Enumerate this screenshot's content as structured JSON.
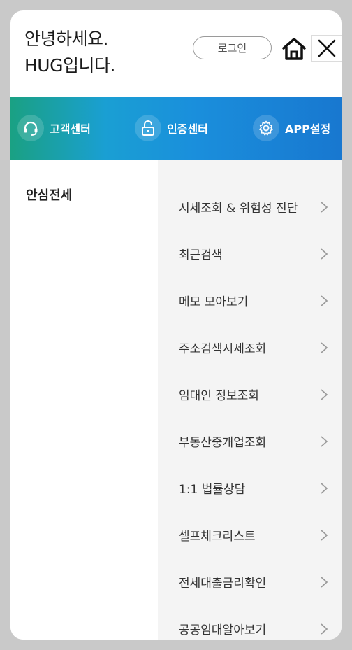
{
  "greeting": {
    "line1": "안녕하세요.",
    "line2": "HUG입니다."
  },
  "header": {
    "login_label": "로그인"
  },
  "quick_bar": [
    {
      "label": "고객센터",
      "icon": "headset-icon"
    },
    {
      "label": "인증센터",
      "icon": "lock-icon"
    },
    {
      "label": "APP설정",
      "icon": "gear-icon"
    }
  ],
  "category": {
    "label": "안심전세"
  },
  "menu": [
    {
      "label": "시세조회 & 위험성 진단"
    },
    {
      "label": "최근검색"
    },
    {
      "label": "메모 모아보기"
    },
    {
      "label": "주소검색시세조회"
    },
    {
      "label": "임대인 정보조회"
    },
    {
      "label": "부동산중개업조회"
    },
    {
      "label": "1:1 법률상담"
    },
    {
      "label": "셀프체크리스트"
    },
    {
      "label": "전세대출금리확인"
    },
    {
      "label": "공공임대알아보기"
    }
  ],
  "colors": {
    "bar_start": "#1aa17a",
    "bar_end": "#1876cf",
    "submenu_bg": "#f4f4f4"
  }
}
